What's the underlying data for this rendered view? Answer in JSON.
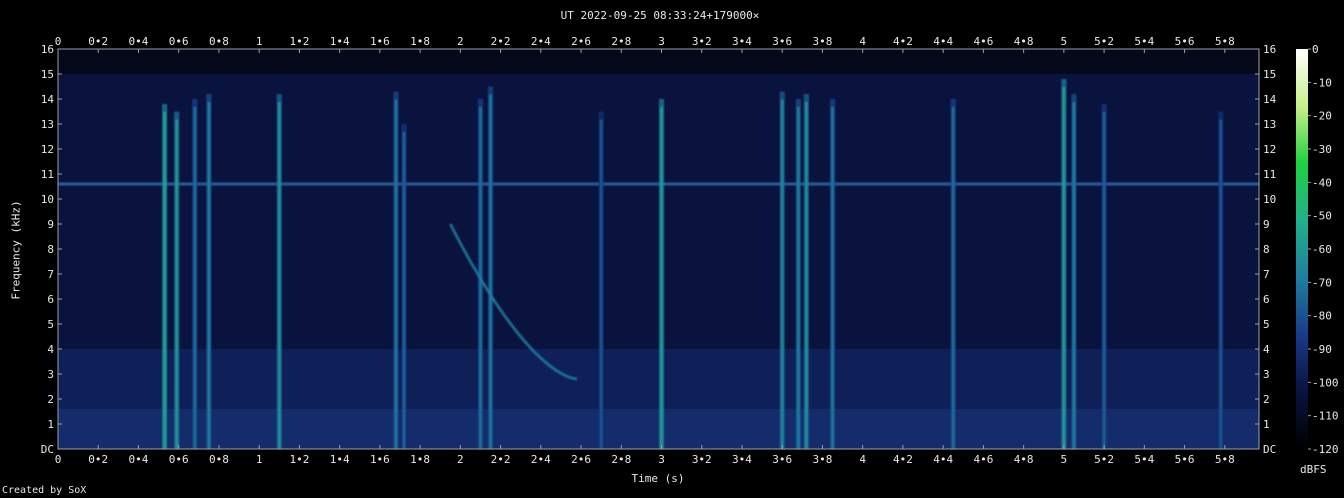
{
  "chart_data": {
    "type": "heatmap",
    "title": "UT 2022-09-25 08:33:24+179000×",
    "xlabel": "Time (s)",
    "ylabel": "Frequency (kHz)",
    "xlim": [
      0,
      5.97
    ],
    "ylim": [
      0,
      16
    ],
    "x_ticks": [
      "0",
      "0•2",
      "0•4",
      "0•6",
      "0•8",
      "1",
      "1•2",
      "1•4",
      "1•6",
      "1•8",
      "2",
      "2•2",
      "2•4",
      "2•6",
      "2•8",
      "3",
      "3•2",
      "3•4",
      "3•6",
      "3•8",
      "4",
      "4•2",
      "4•4",
      "4•6",
      "4•8",
      "5",
      "5•2",
      "5•4",
      "5•6",
      "5•8"
    ],
    "x_tick_values": [
      0,
      0.2,
      0.4,
      0.6,
      0.8,
      1,
      1.2,
      1.4,
      1.6,
      1.8,
      2,
      2.2,
      2.4,
      2.6,
      2.8,
      3,
      3.2,
      3.4,
      3.6,
      3.8,
      4,
      4.2,
      4.4,
      4.6,
      4.8,
      5,
      5.2,
      5.4,
      5.6,
      5.8
    ],
    "y_ticks": [
      "DC",
      "1",
      "2",
      "3",
      "4",
      "5",
      "6",
      "7",
      "8",
      "9",
      "10",
      "11",
      "12",
      "13",
      "14",
      "15",
      "16"
    ],
    "colorbar": {
      "label": "dBFS",
      "ticks": [
        "0",
        "-10",
        "-20",
        "-30",
        "-40",
        "-50",
        "-60",
        "-70",
        "-80",
        "-90",
        "-100",
        "-110",
        "-120"
      ],
      "range": [
        -120,
        0
      ],
      "colors": [
        "#000000",
        "#0a1240",
        "#1a3a8a",
        "#1f7fa0",
        "#22b08a",
        "#20d040",
        "#c8f08a",
        "#ffffff"
      ]
    },
    "persistent_tone_khz": 10.6,
    "transients": [
      {
        "t": 0.53,
        "fmax": 13.8,
        "level": -55
      },
      {
        "t": 0.59,
        "fmax": 13.5,
        "level": -60
      },
      {
        "t": 0.68,
        "fmax": 14.0,
        "level": -72
      },
      {
        "t": 0.75,
        "fmax": 14.2,
        "level": -68
      },
      {
        "t": 1.1,
        "fmax": 14.2,
        "level": -62
      },
      {
        "t": 1.68,
        "fmax": 14.3,
        "level": -70
      },
      {
        "t": 1.72,
        "fmax": 13.0,
        "level": -75
      },
      {
        "t": 2.1,
        "fmax": 14.0,
        "level": -72
      },
      {
        "t": 2.15,
        "fmax": 14.5,
        "level": -70
      },
      {
        "t": 2.7,
        "fmax": 13.5,
        "level": -78
      },
      {
        "t": 3.0,
        "fmax": 14.0,
        "level": -58
      },
      {
        "t": 3.6,
        "fmax": 14.3,
        "level": -65
      },
      {
        "t": 3.68,
        "fmax": 14.0,
        "level": -68
      },
      {
        "t": 3.72,
        "fmax": 14.2,
        "level": -62
      },
      {
        "t": 3.85,
        "fmax": 14.0,
        "level": -70
      },
      {
        "t": 4.45,
        "fmax": 14.0,
        "level": -72
      },
      {
        "t": 5.0,
        "fmax": 14.8,
        "level": -58
      },
      {
        "t": 5.05,
        "fmax": 14.2,
        "level": -68
      },
      {
        "t": 5.2,
        "fmax": 13.8,
        "level": -76
      },
      {
        "t": 5.78,
        "fmax": 13.5,
        "level": -78
      }
    ],
    "chirp": {
      "t_start": 1.95,
      "f_start_khz": 9.0,
      "t_end": 2.58,
      "f_end_khz": 2.8
    }
  },
  "footer": {
    "credit": "Created by SoX"
  }
}
